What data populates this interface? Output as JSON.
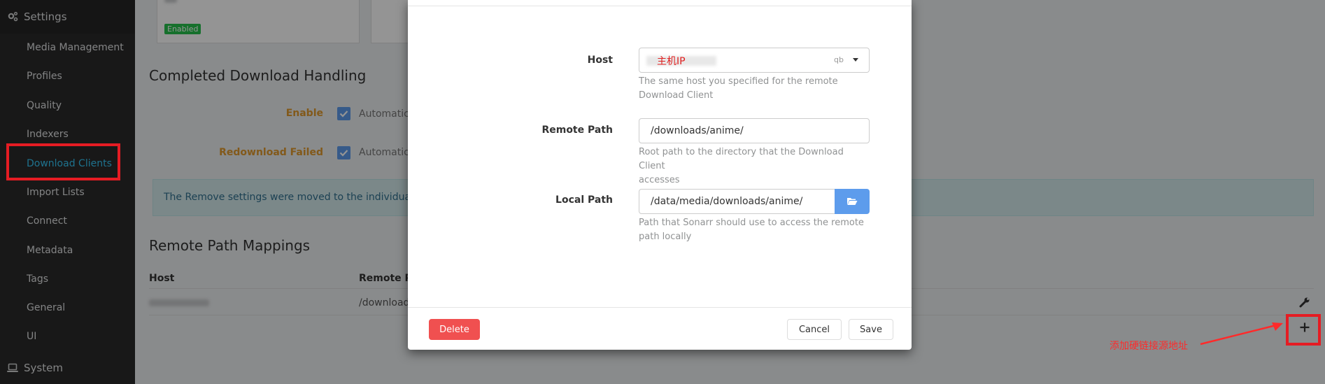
{
  "sidebar": {
    "settings_label": "Settings",
    "items": [
      {
        "label": "Media Management"
      },
      {
        "label": "Profiles"
      },
      {
        "label": "Quality"
      },
      {
        "label": "Indexers"
      },
      {
        "label": "Download Clients"
      },
      {
        "label": "Import Lists"
      },
      {
        "label": "Connect"
      },
      {
        "label": "Metadata"
      },
      {
        "label": "Tags"
      },
      {
        "label": "General"
      },
      {
        "label": "UI"
      }
    ],
    "system_label": "System"
  },
  "main": {
    "client_card_status": "Enabled",
    "completed_handling": {
      "title": "Completed Download Handling",
      "enable_label": "Enable",
      "enable_text": "Automatica",
      "redownload_label": "Redownload Failed",
      "redownload_text": "Automatica",
      "alert_text": "The Remove settings were moved to the individual Down"
    },
    "remote_mappings": {
      "title": "Remote Path Mappings",
      "col_host": "Host",
      "col_remote": "Remote Pat",
      "row_remote": "/downloads"
    }
  },
  "modal": {
    "host": {
      "label": "Host",
      "value": "主机IP",
      "suffix": "qb",
      "help": [
        "The same host you specified for the remote",
        "Download Client"
      ]
    },
    "remote_path": {
      "label": "Remote Path",
      "value": "/downloads/anime/",
      "help": [
        "Root path to the directory that the Download Client",
        "accesses"
      ]
    },
    "local_path": {
      "label": "Local Path",
      "value": "/data/media/downloads/anime/",
      "help": [
        "Path that Sonarr should use to access the remote",
        "path locally"
      ]
    },
    "delete_label": "Delete",
    "cancel_label": "Cancel",
    "save_label": "Save"
  },
  "annotation": {
    "text": "添加硬链接源地址"
  },
  "colors": {
    "sidebar_bg": "#2a2a2a",
    "active_link": "#35c5f4",
    "warning_label": "#e09a2d",
    "primary": "#5d9cec",
    "danger": "#f05050",
    "annotation_red": "#ff2a2a"
  }
}
